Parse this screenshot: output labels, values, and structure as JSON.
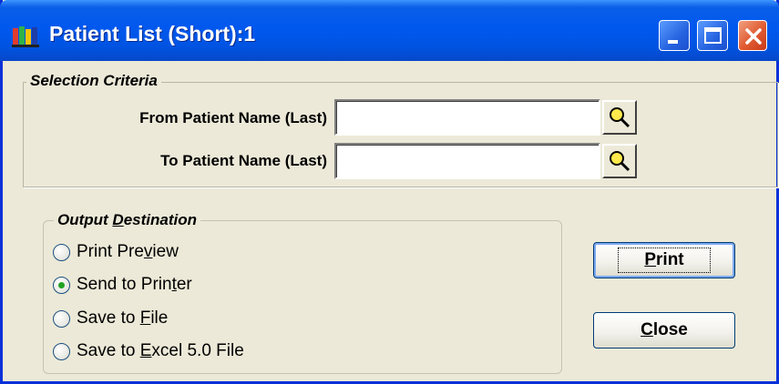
{
  "window": {
    "title": "Patient List (Short):1",
    "controls": [
      "minimize-icon",
      "maximize-icon",
      "close-icon"
    ]
  },
  "selection_criteria": {
    "legend": "Selection Criteria",
    "from_label": "From Patient Name (Last)",
    "from_value": "",
    "to_label": "To Patient Name (Last)",
    "to_value": ""
  },
  "output_destination": {
    "legend_pre": "Output ",
    "legend_mnemonic": "D",
    "legend_post": "estination",
    "options": [
      {
        "pre": "Print Pre",
        "mnemonic": "v",
        "post": "iew",
        "selected": false
      },
      {
        "pre": "Send to Prin",
        "mnemonic": "t",
        "post": "er",
        "selected": true
      },
      {
        "pre": "Save to ",
        "mnemonic": "F",
        "post": "ile",
        "selected": false
      },
      {
        "pre": "Save to ",
        "mnemonic": "E",
        "post": "xcel 5.0 File",
        "selected": false
      }
    ]
  },
  "buttons": {
    "print_pre": "",
    "print_mnemonic": "P",
    "print_post": "rint",
    "close_pre": "",
    "close_mnemonic": "C",
    "close_post": "lose"
  },
  "colors": {
    "titlebar": "#0054e3",
    "face": "#ece9d8",
    "radio_selected": "#21a121"
  }
}
